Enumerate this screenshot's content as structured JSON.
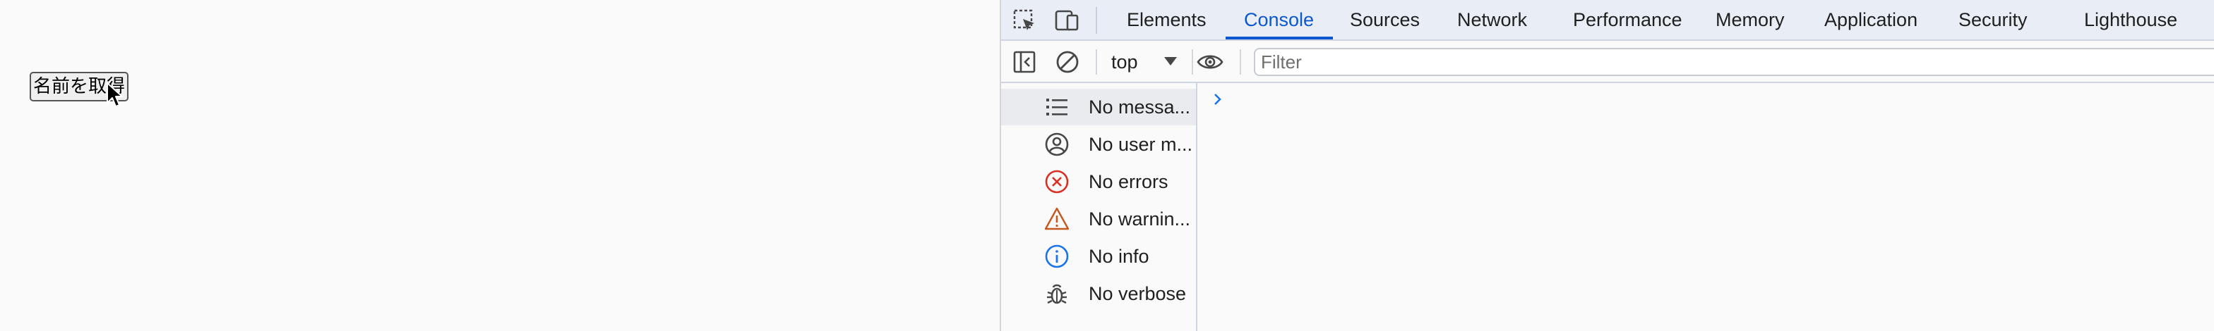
{
  "page": {
    "button_label": "名前を取得"
  },
  "devtools": {
    "tabs": [
      {
        "label": "Elements",
        "active": false
      },
      {
        "label": "Console",
        "active": true
      },
      {
        "label": "Sources",
        "active": false
      },
      {
        "label": "Network",
        "active": false
      },
      {
        "label": "Performance",
        "active": false
      },
      {
        "label": "Memory",
        "active": false
      },
      {
        "label": "Application",
        "active": false
      },
      {
        "label": "Security",
        "active": false
      },
      {
        "label": "Lighthouse",
        "active": false
      }
    ],
    "toolbar": {
      "context": "top",
      "filter_placeholder": "Filter"
    },
    "sidebar": {
      "items": [
        {
          "label": "No messa...",
          "icon": "list-icon",
          "selected": true
        },
        {
          "label": "No user m...",
          "icon": "user-icon",
          "selected": false
        },
        {
          "label": "No errors",
          "icon": "error-icon",
          "selected": false
        },
        {
          "label": "No warnin...",
          "icon": "warning-icon",
          "selected": false
        },
        {
          "label": "No info",
          "icon": "info-icon",
          "selected": false
        },
        {
          "label": "No verbose",
          "icon": "bug-icon",
          "selected": false
        }
      ]
    },
    "colors": {
      "accent": "#0b57d0",
      "error": "#d93025",
      "warning": "#c5581f",
      "info": "#1a73e8",
      "tabbar_bg": "#e9eef6"
    }
  }
}
